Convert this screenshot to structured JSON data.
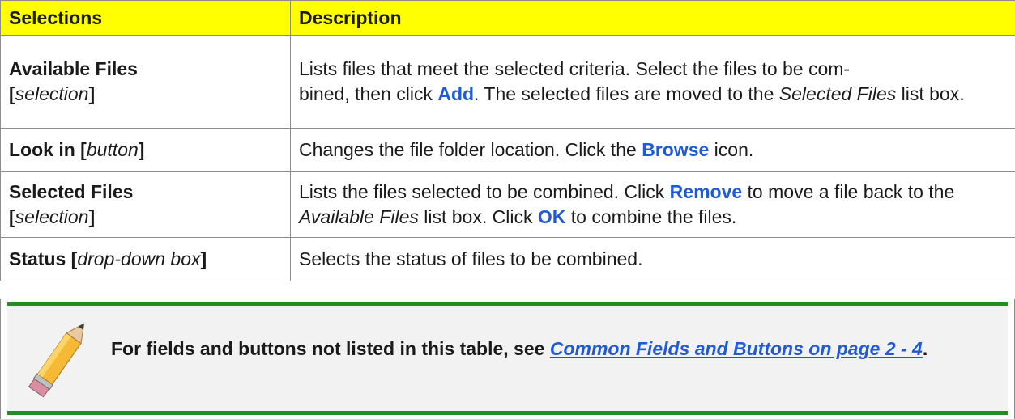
{
  "table": {
    "headers": {
      "selections": "Selections",
      "description": "Description"
    },
    "rows": [
      {
        "sel_bold": "Available Files",
        "sel_open": "[",
        "sel_italic": "selection",
        "sel_close": "]",
        "desc": {
          "a": "Lists files that meet the selected criteria. Select the files to be com-",
          "b": "bined, then click ",
          "kw1": "Add",
          "c": ". The selected files are moved to the ",
          "it1": "Selected Files",
          "d": " list box."
        }
      },
      {
        "sel_bold": "Look in [",
        "sel_italic": "button",
        "sel_close": "]",
        "desc": {
          "a": "Changes the file folder location. Click the ",
          "kw1": "Browse",
          "b": " icon."
        }
      },
      {
        "sel_bold": "Selected Files",
        "sel_open": "[",
        "sel_italic": "selection",
        "sel_close": "]",
        "desc": {
          "a": "Lists the files selected to be combined. Click ",
          "kw1": "Remove",
          "b": " to move a file back to the ",
          "it1": "Available Files",
          "c": " list box. Click ",
          "kw2": "OK",
          "d": " to combine the files."
        }
      },
      {
        "sel_bold": "Status [",
        "sel_italic": "drop-down box",
        "sel_close": "]",
        "desc": {
          "a": "Selects the status of files to be combined."
        }
      }
    ]
  },
  "note": {
    "icon": "pencil-icon",
    "text_before": "For fields and buttons not listed in this table, see ",
    "link_text": "Common Fields and Buttons on page 2 - 4",
    "text_after": "."
  },
  "colors": {
    "header_bg": "#ffff00",
    "keyword": "#1f5bd6",
    "note_border": "#1f8f1f",
    "note_bg": "#f2f2f2"
  }
}
